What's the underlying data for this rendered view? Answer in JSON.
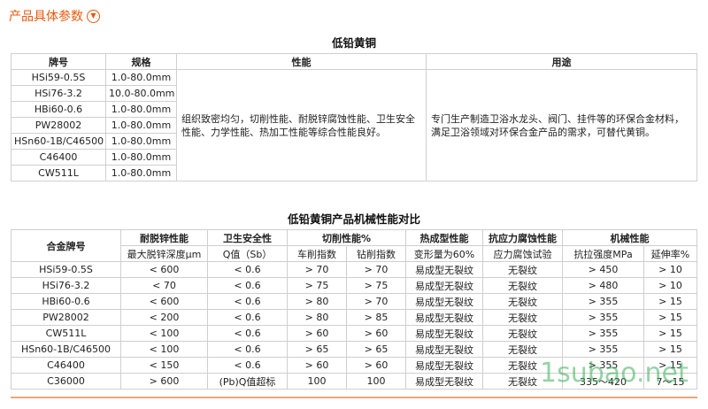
{
  "header": {
    "title": "产品具体参数"
  },
  "table1": {
    "caption": "低铅黄铜",
    "headers": [
      "牌号",
      "规格",
      "性能",
      "用途"
    ],
    "rows": [
      [
        "HSi59-0.5S",
        "1.0-80.0mm"
      ],
      [
        "HSi76-3.2",
        "10.0-80.0mm"
      ],
      [
        "HBi60-0.6",
        "1.0-80.0mm"
      ],
      [
        "PW28002",
        "1.0-80.0mm"
      ],
      [
        "HSn60-1B/C46500",
        "1.0-80.0mm"
      ],
      [
        "C46400",
        "1.0-80.0mm"
      ],
      [
        "CW511L",
        "1.0-80.0mm"
      ]
    ],
    "performance": "组织致密均匀，切削性能、耐脱锌腐蚀性能、卫生安全性能、力学性能、热加工性能等综合性能良好。",
    "usage": "专门生产制造卫浴水龙头、阀门、挂件等的环保合金材料，满足卫浴领域对环保合金产品的需求，可替代黄铜。"
  },
  "table2": {
    "caption": "低铅黄铜产品机械性能对比",
    "alloy_header": "合金牌号",
    "groups": [
      "耐脱锌性能",
      "卫生安全性",
      "切削性能%",
      "热成型性能",
      "抗应力腐蚀性能",
      "机械性能"
    ],
    "subheaders": [
      "最大脱锌深度μm",
      "Q值（Sb）",
      "车削指数",
      "钻削指数",
      "变形量为60%",
      "应力腐蚀试验",
      "抗拉强度MPa",
      "延伸率%"
    ],
    "rows": [
      [
        "HSi59-0.5S",
        "< 600",
        "< 0.6",
        "> 70",
        "> 70",
        "易成型无裂纹",
        "无裂纹",
        "> 450",
        "> 10"
      ],
      [
        "HSi76-3.2",
        "< 70",
        "< 0.6",
        "> 75",
        "> 75",
        "易成型无裂纹",
        "无裂纹",
        "> 480",
        "> 10"
      ],
      [
        "HBi60-0.6",
        "< 600",
        "< 0.6",
        "> 80",
        "> 70",
        "易成型无裂纹",
        "无裂纹",
        "> 355",
        "> 15"
      ],
      [
        "PW28002",
        "< 200",
        "< 0.6",
        "> 80",
        "> 85",
        "易成型无裂纹",
        "无裂纹",
        "> 355",
        "> 15"
      ],
      [
        "CW511L",
        "< 100",
        "< 0.6",
        "> 60",
        "> 60",
        "易成型无裂纹",
        "无裂纹",
        "> 355",
        "> 15"
      ],
      [
        "HSn60-1B/C46500",
        "< 100",
        "< 0.6",
        "> 65",
        "> 65",
        "易成型无裂纹",
        "无裂纹",
        "> 355",
        "> 15"
      ],
      [
        "C46400",
        "< 150",
        "< 0.6",
        "> 60",
        "> 60",
        "易成型无裂纹",
        "无裂纹",
        "> 355",
        "> 15"
      ],
      [
        "C36000",
        "> 600",
        "(Pb)Q值超标",
        "100",
        "100",
        "易成型无裂纹",
        "无裂纹",
        "335～420",
        "7～15"
      ]
    ]
  },
  "watermark": "1subao.net",
  "colors": {
    "accent": "#e8590c",
    "border": "#cfcfcf",
    "footer": "#f2a27a",
    "watermark": "#3caf5a"
  },
  "icons": {
    "header": "chevron-down-circle-icon"
  }
}
